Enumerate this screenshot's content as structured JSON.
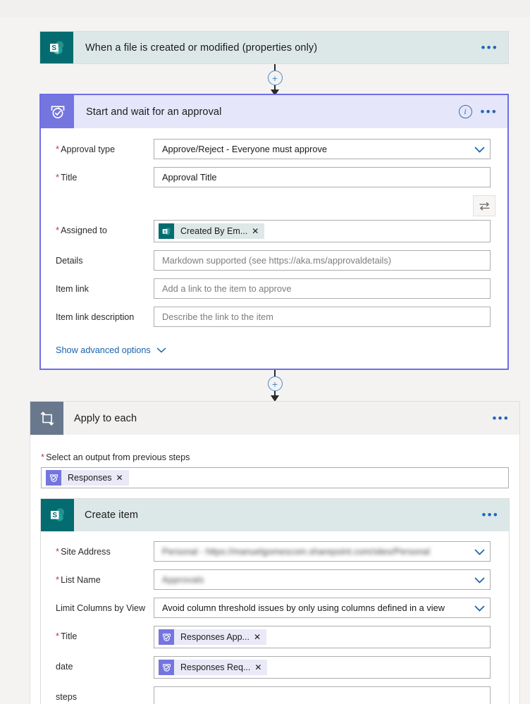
{
  "theme": {
    "page_bg": "#f4f3f2",
    "sharepoint_teal": "#046c70",
    "sharepoint_header_bg": "#dce8e7",
    "approval_purple": "#7575e0",
    "approval_header_bg": "#e6e6fa",
    "selected_border": "#6e6ee8",
    "loop_gray": "#69788c",
    "link_blue": "#1964ac",
    "required_red": "#c0304a"
  },
  "trigger": {
    "title": "When a file is created or modified (properties only)",
    "icon": "sharepoint-icon",
    "menu": "•••"
  },
  "connector": {
    "plus": "+"
  },
  "approval": {
    "title": "Start and wait for an approval",
    "icon": "approvals-icon",
    "info": "i",
    "menu": "•••",
    "fields": [
      {
        "label": "Approval type",
        "required": true,
        "kind": "dropdown",
        "value": "Approve/Reject - Everyone must approve"
      },
      {
        "label": "Title",
        "required": true,
        "kind": "text",
        "value": "Approval Title"
      },
      {
        "label": "Assigned to",
        "required": true,
        "kind": "token",
        "token": {
          "text": "Created By Em...",
          "icon": "sharepoint-icon",
          "remove": "✕"
        }
      },
      {
        "label": "Details",
        "required": false,
        "kind": "text",
        "placeholder": "Markdown supported (see https://aka.ms/approvaldetails)"
      },
      {
        "label": "Item link",
        "required": false,
        "kind": "text",
        "placeholder": "Add a link to the item to approve"
      },
      {
        "label": "Item link description",
        "required": false,
        "kind": "text",
        "placeholder": "Describe the link to the item"
      }
    ],
    "swap_icon": "swap-arrows-icon",
    "advanced_options": "Show advanced options"
  },
  "loop": {
    "title": "Apply to each",
    "icon": "repeat-loop-icon",
    "menu": "•••",
    "select_output_label": "Select an output from previous steps",
    "select_output_required": true,
    "token": {
      "text": "Responses",
      "icon": "approvals-icon",
      "remove": "✕"
    }
  },
  "create_item": {
    "title": "Create item",
    "icon": "sharepoint-icon",
    "menu": "•••",
    "fields": [
      {
        "label": "Site Address",
        "required": true,
        "kind": "dropdown-redacted",
        "value": "Personal - https://manuelgomescom.sharepoint.com/sites/Personal"
      },
      {
        "label": "List Name",
        "required": true,
        "kind": "dropdown-redacted",
        "value": "Approvals"
      },
      {
        "label": "Limit Columns by View",
        "required": false,
        "kind": "dropdown",
        "value": "Avoid column threshold issues by only using columns defined in a view"
      },
      {
        "label": "Title",
        "required": true,
        "kind": "token",
        "token": {
          "text": "Responses App...",
          "icon": "approvals-icon",
          "remove": "✕"
        }
      },
      {
        "label": "date",
        "required": false,
        "kind": "token",
        "token": {
          "text": "Responses Req...",
          "icon": "approvals-icon",
          "remove": "✕"
        }
      },
      {
        "label": "steps",
        "required": false,
        "kind": "text",
        "placeholder": ""
      }
    ]
  }
}
